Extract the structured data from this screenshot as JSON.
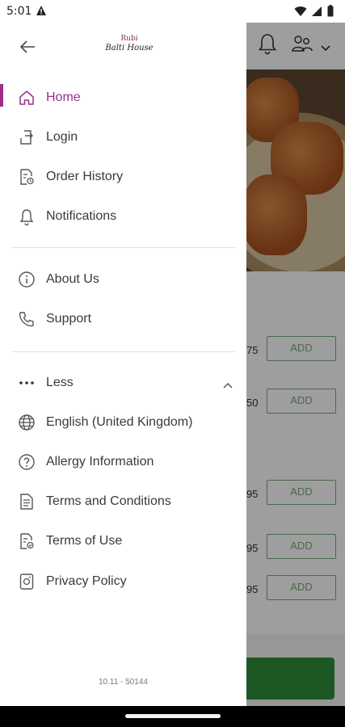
{
  "status_bar": {
    "time": "5:01"
  },
  "logo": {
    "line1": "Rubi",
    "line2": "Balti House"
  },
  "menu": {
    "primary": [
      {
        "label": "Home",
        "icon": "home-icon",
        "active": true
      },
      {
        "label": "Login",
        "icon": "login-icon"
      },
      {
        "label": "Order History",
        "icon": "order-history-icon"
      },
      {
        "label": "Notifications",
        "icon": "bell-icon"
      }
    ],
    "secondary": [
      {
        "label": "About Us",
        "icon": "info-icon"
      },
      {
        "label": "Support",
        "icon": "phone-icon"
      }
    ],
    "more_toggle": {
      "label": "Less",
      "icon": "more-dots-icon"
    },
    "extra": [
      {
        "label": "English (United Kingdom)",
        "icon": "globe-icon"
      },
      {
        "label": "Allergy Information",
        "icon": "question-icon"
      },
      {
        "label": "Terms and Conditions",
        "icon": "document-icon"
      },
      {
        "label": "Terms of Use",
        "icon": "document-check-icon"
      },
      {
        "label": "Privacy Policy",
        "icon": "privacy-icon"
      }
    ]
  },
  "version": "10.11 - 50144",
  "background": {
    "prices": [
      "75",
      "50",
      "95",
      "95",
      "95"
    ],
    "add_label": "ADD"
  },
  "colors": {
    "accent": "#9c2f86",
    "cta": "#2f8f3a",
    "add_border": "#7aa87a"
  }
}
